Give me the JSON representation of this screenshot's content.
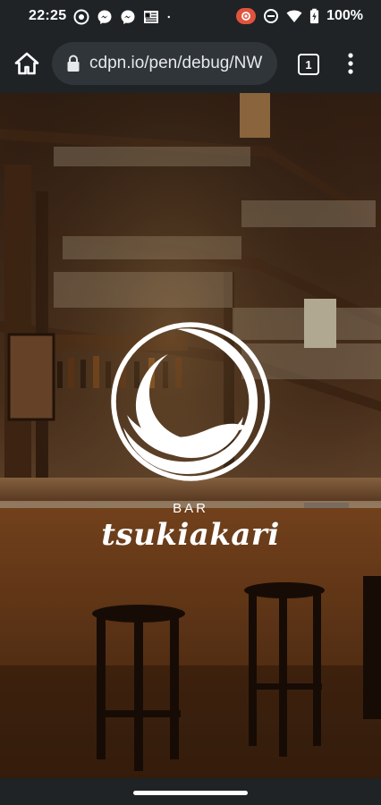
{
  "status_bar": {
    "time": "22:25",
    "left_icons": [
      "cast-icon",
      "messenger-icon",
      "messenger-icon",
      "newspaper-icon",
      "dot-icon"
    ],
    "right_icons": [
      "record-icon",
      "dnd-icon",
      "wifi-icon",
      "battery-charging-icon"
    ],
    "battery_percent": "100%"
  },
  "browser": {
    "url": "cdpn.io/pen/debug/NW",
    "tab_count": "1",
    "home_icon": "home-icon",
    "lock_icon": "lock-icon",
    "menu_icon": "more-vert-icon"
  },
  "page": {
    "brand_prefix": "BAR",
    "brand_name": "tsukiakari",
    "logo": "crescent-moon-wave-logo",
    "background": "bar-interior-photo"
  },
  "colors": {
    "chrome_bg": "#1f2326",
    "url_pill_bg": "#2f3539",
    "logo": "#ffffff",
    "record_accent": "#e0533d"
  }
}
